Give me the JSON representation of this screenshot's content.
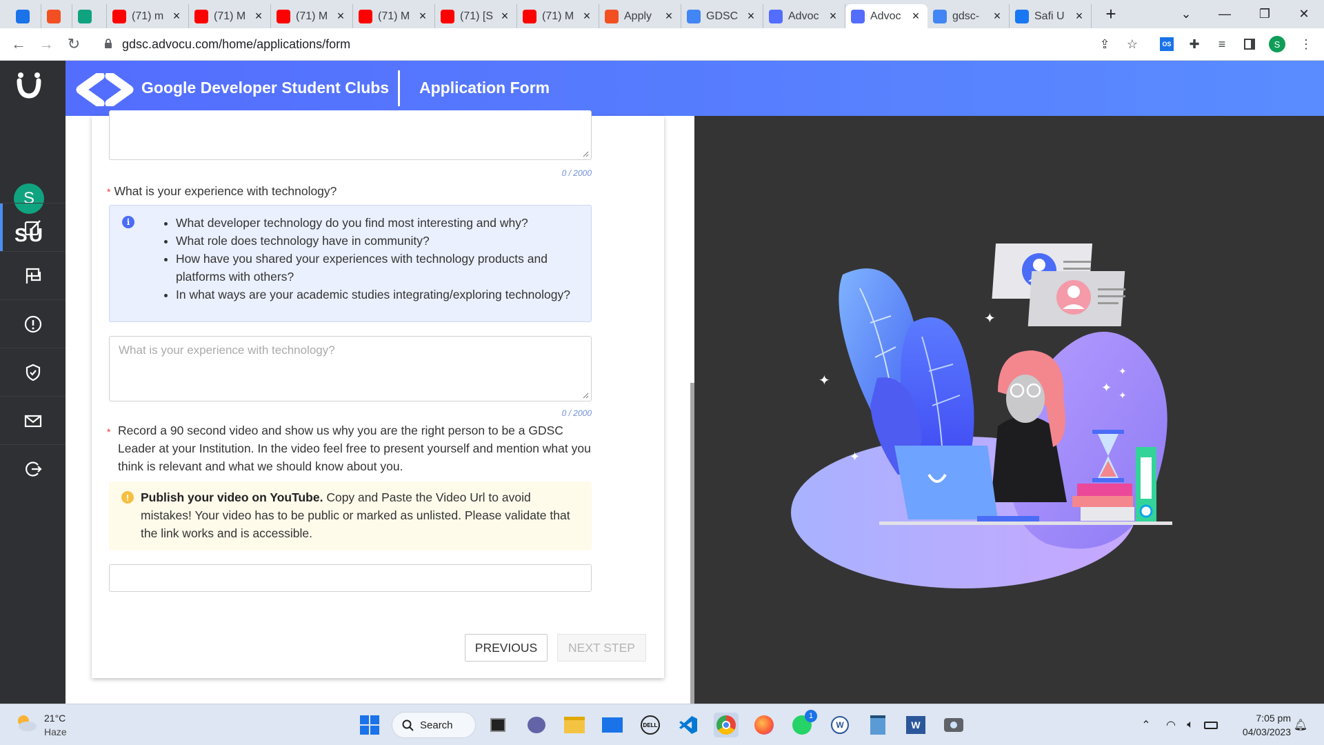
{
  "browser": {
    "tabs": [
      {
        "title": "",
        "favicon": "chromium-icon",
        "color": "#1a73e8"
      },
      {
        "title": "",
        "favicon": "microsoft-icon",
        "color": "#f25022"
      },
      {
        "title": "",
        "favicon": "chatgpt-icon",
        "color": "#10a37f"
      },
      {
        "title": "(71) m",
        "favicon": "youtube-icon",
        "color": "#ff0000"
      },
      {
        "title": "(71) M",
        "favicon": "youtube-icon",
        "color": "#ff0000"
      },
      {
        "title": "(71) M",
        "favicon": "youtube-icon",
        "color": "#ff0000"
      },
      {
        "title": "(71) M",
        "favicon": "youtube-icon",
        "color": "#ff0000"
      },
      {
        "title": "(71) [S",
        "favicon": "youtube-icon",
        "color": "#ff0000"
      },
      {
        "title": "(71) M",
        "favicon": "youtube-icon",
        "color": "#ff0000"
      },
      {
        "title": "Apply",
        "favicon": "microsoft-icon",
        "color": "#f25022"
      },
      {
        "title": "GDSC",
        "favicon": "gdsc-icon",
        "color": "#4285f4"
      },
      {
        "title": "Advoc",
        "favicon": "advocu-icon",
        "color": "#536dfe"
      },
      {
        "title": "Advoc",
        "favicon": "advocu-icon",
        "color": "#536dfe"
      },
      {
        "title": "gdsc-",
        "favicon": "google-icon",
        "color": "#4285f4"
      },
      {
        "title": "Safi U",
        "favicon": "facebook-icon",
        "color": "#1877f2"
      }
    ],
    "url": "gdsc.advocu.com/home/applications/form",
    "profile_initial": "S"
  },
  "sidebar": {
    "avatar_initial": "S",
    "user_initials": "SU"
  },
  "banner": {
    "brand": "Google Developer Student Clubs",
    "page_title": "Application Form"
  },
  "form": {
    "top_counter": "0 / 2000",
    "q_experience": {
      "label": "What is your experience with technology?",
      "hints": [
        "What developer technology do you find most interesting and why?",
        "What role does technology have in community?",
        "How have you shared your experiences with technology products and platforms with others?",
        "In what ways are your academic studies integrating/exploring technology?"
      ],
      "placeholder": "What is your experience with technology?",
      "counter": "0 / 2000"
    },
    "q_video": {
      "label": "Record a 90 second video and show us why you are the right person to be a GDSC Leader at your Institution. In the video feel free to present yourself and mention what you think is relevant and what we should know about you.",
      "warning_bold": "Publish your video on YouTube.",
      "warning_text": " Copy and Paste the Video Url to avoid mistakes! Your video has to be public or marked as unlisted. Please validate that the link works and is accessible."
    },
    "buttons": {
      "previous": "PREVIOUS",
      "next": "NEXT STEP"
    }
  },
  "taskbar": {
    "temperature": "21°C",
    "condition": "Haze",
    "search_label": "Search",
    "whatsapp_badge": "1",
    "time": "7:05 pm",
    "date": "04/03/2023"
  }
}
